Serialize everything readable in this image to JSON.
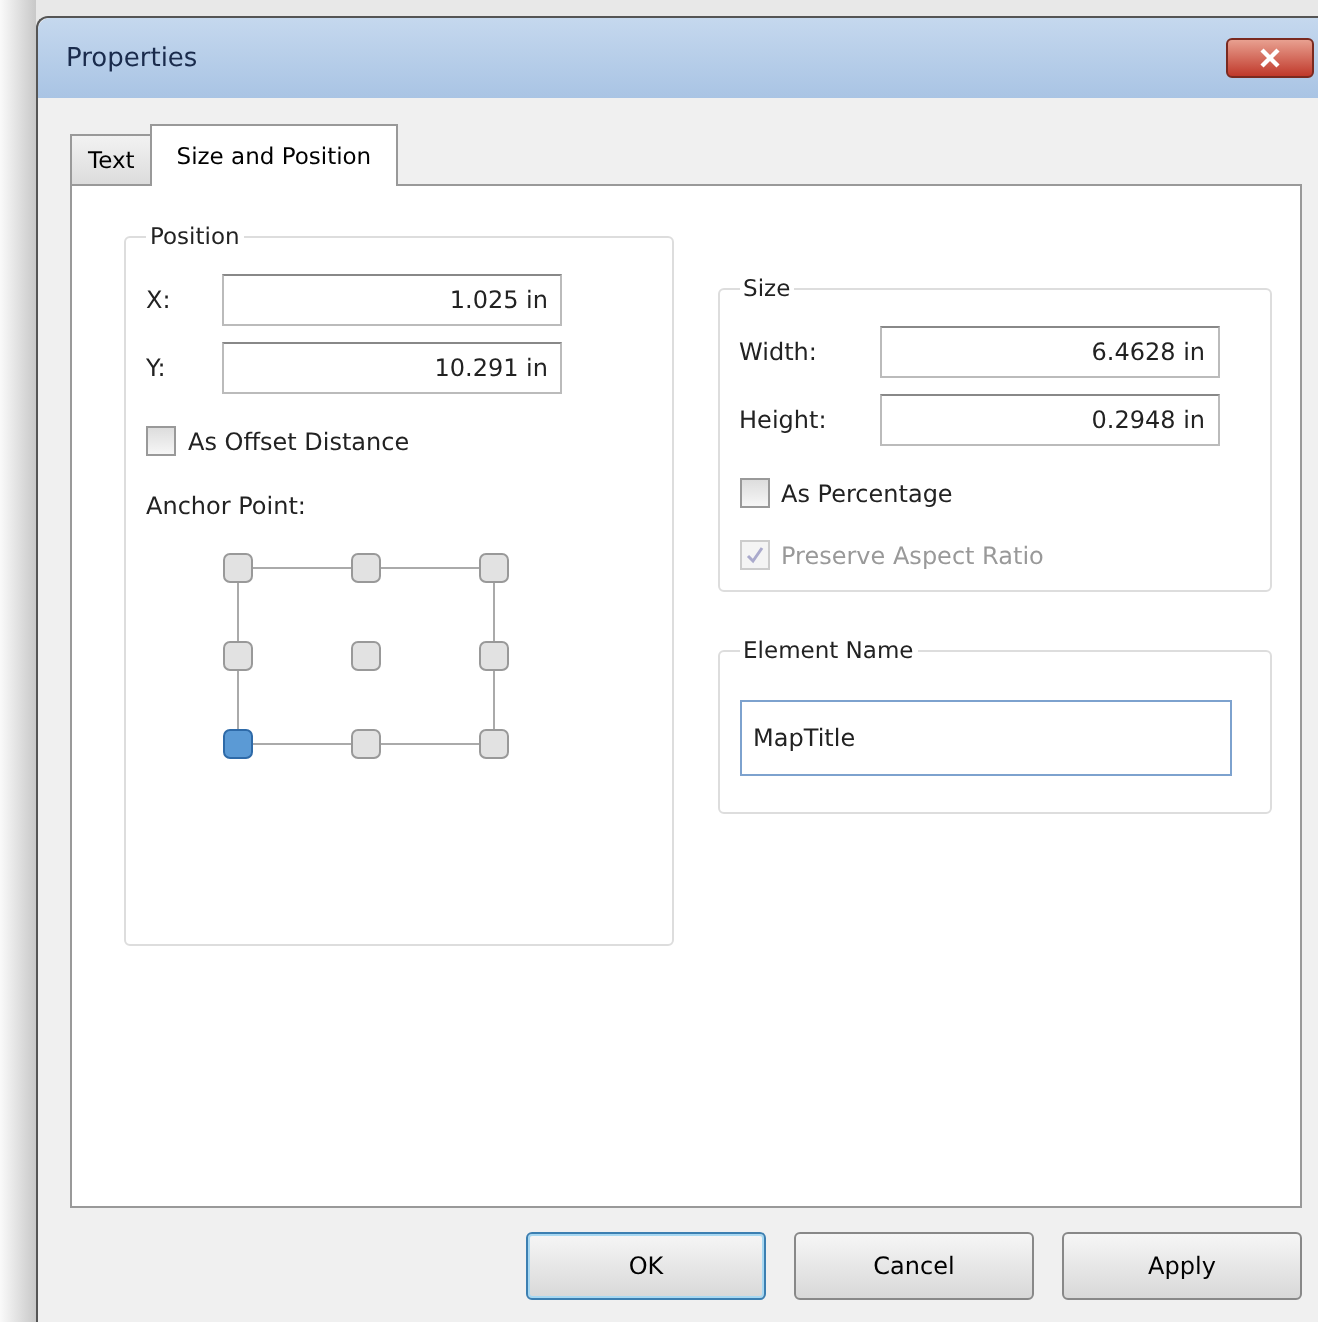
{
  "window": {
    "title": "Properties"
  },
  "tabs": [
    {
      "label": "Text",
      "selected": false
    },
    {
      "label": "Size and Position",
      "selected": true
    }
  ],
  "position": {
    "title": "Position",
    "fields": [
      {
        "label": "X:",
        "value": "1.025 in"
      },
      {
        "label": "Y:",
        "value": "10.291 in"
      }
    ],
    "offset": {
      "label": "As Offset Distance",
      "checked": false
    },
    "anchor_label": "Anchor Point:",
    "anchors": [
      {
        "selected": false
      },
      {
        "selected": false
      },
      {
        "selected": false
      },
      {
        "selected": false
      },
      {
        "selected": false
      },
      {
        "selected": false
      },
      {
        "selected": true
      },
      {
        "selected": false
      },
      {
        "selected": false
      }
    ]
  },
  "size": {
    "title": "Size",
    "fields": [
      {
        "label": "Width:",
        "value": "6.4628 in"
      },
      {
        "label": "Height:",
        "value": "0.2948 in"
      }
    ],
    "options": [
      {
        "label": "As Percentage",
        "checked": false,
        "disabled": false
      },
      {
        "label": "Preserve Aspect Ratio",
        "checked": true,
        "disabled": true
      }
    ]
  },
  "element_name": {
    "title": "Element Name",
    "value": "MapTitle"
  },
  "buttons": [
    {
      "label": "OK",
      "default": true
    },
    {
      "label": "Cancel",
      "default": false
    },
    {
      "label": "Apply",
      "default": false
    }
  ]
}
